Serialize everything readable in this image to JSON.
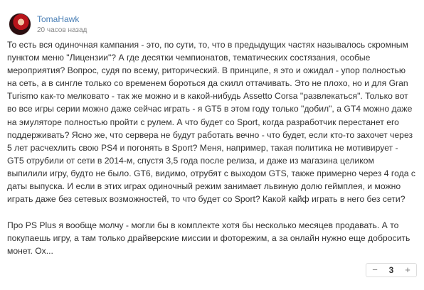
{
  "comment": {
    "author": "TomaHawk",
    "time": "20 часов назад",
    "paragraphs": [
      "То есть вся одиночная кампания - это, по сути, то, что в предыдущих частях называлось скромным пунктом меню \"Лицензии\"? А где десятки чемпионатов, тематических состязания, особые мероприятия? Вопрос, судя по всему, риторический. В принципе, я это и ожидал - упор полностью на сеть, а в сингле только со временем бороться да скилл оттачивать. Это не плохо, но и для Gran Turismo как-то мелковато - так же можно и в какой-нибудь Assetto Corsa \"развлекаться\". Только вот во все игры серии можно даже сейчас играть - я GT5 в этом году только \"добил\", а GT4 можно даже на эмуляторе полностью пройти с рулем. А что будет со Sport, когда разработчик перестанет его поддерживать? Ясно же, что сервера не будут работать вечно - что будет, если кто-то захочет через 5 лет расчехлить свою PS4 и погонять в Sport? Меня, например, такая политика не мотивирует - GT5 отрубили от сети в 2014-м, спустя 3,5 года после релиза, и даже из магазина целиком выпилили игру, будто не было. GT6, видимо, отрубят с выходом GTS, также примерно через 4 года с даты выпуска. И если в этих играх одиночный режим занимает львиную долю геймплея, и можно играть даже без сетевых возможностей, то что будет со Sport? Какой кайф играть в него без сети?",
      "Про PS Plus я вообще молчу - могли бы в комплекте хотя бы несколько месяцев продавать. А то покупаешь игру, а там только драйверские миссии и фоторежим, а за онлайн нужно еще добросить монет. Ох..."
    ]
  },
  "vote": {
    "minus": "−",
    "count": "3",
    "plus": "+"
  }
}
